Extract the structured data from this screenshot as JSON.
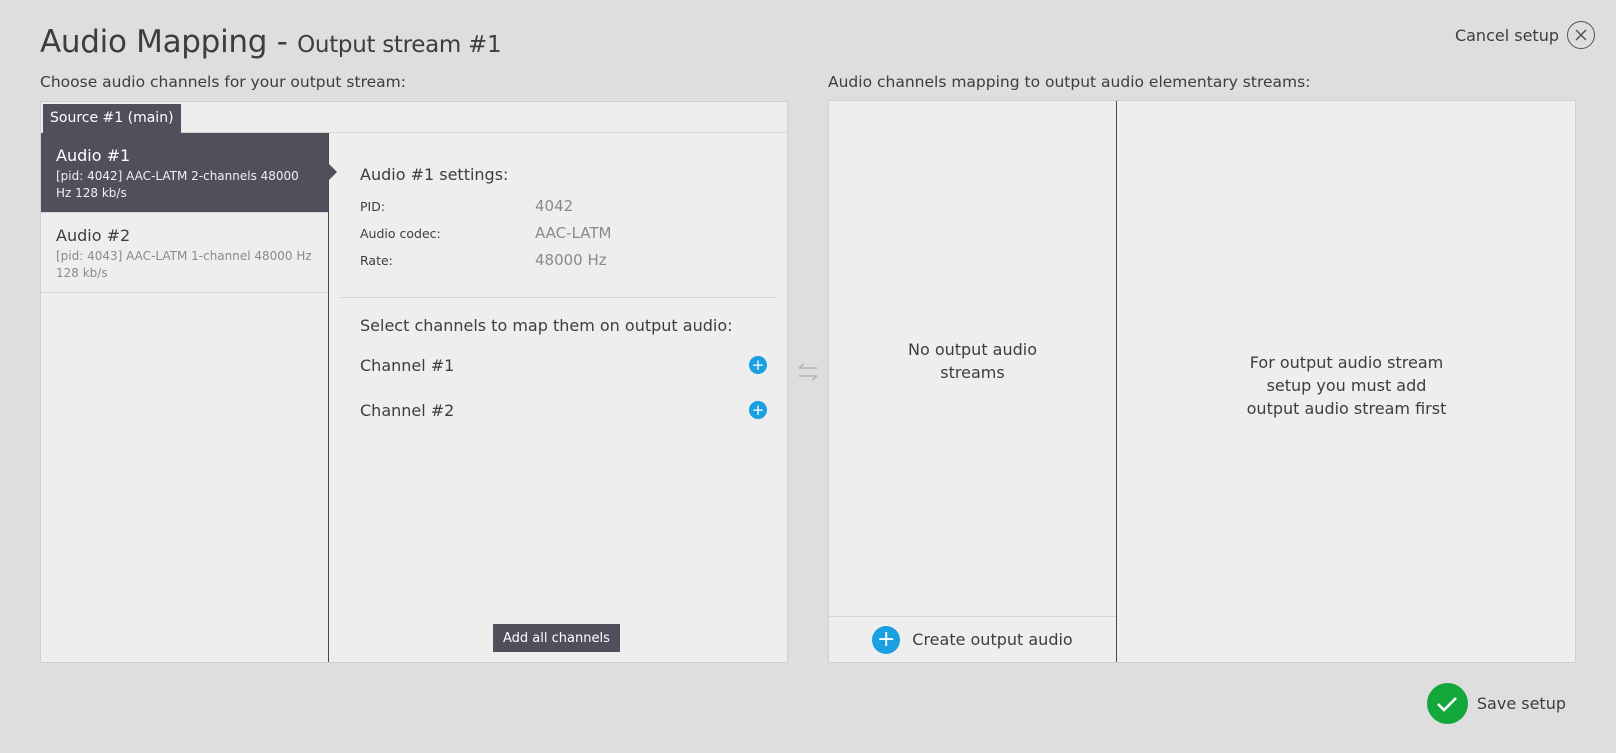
{
  "header": {
    "title": "Audio Mapping - ",
    "subtitle": "Output stream #1",
    "cancel_label": "Cancel setup"
  },
  "left": {
    "label": "Choose audio channels for your output stream:",
    "source_tab": "Source #1 (main)",
    "audio_items": [
      {
        "name": "Audio #1",
        "desc": "[pid: 4042] AAC-LATM 2-channels 48000 Hz 128 kb/s",
        "active": true
      },
      {
        "name": "Audio #2",
        "desc": "[pid: 4043] AAC-LATM 1-channel 48000 Hz 128 kb/s",
        "active": false
      }
    ],
    "settings": {
      "title": "Audio #1 settings:",
      "fields": [
        {
          "key": "PID:",
          "value": "4042"
        },
        {
          "key": "Audio codec:",
          "value": "AAC-LATM"
        },
        {
          "key": "Rate:",
          "value": "48000 Hz"
        }
      ],
      "select_title": "Select channels to map them on output audio:",
      "channels": [
        "Channel #1",
        "Channel #2"
      ],
      "add_all_label": "Add all channels"
    }
  },
  "right": {
    "label": "Audio channels mapping to output audio elementary streams:",
    "no_streams": "No output audio streams",
    "create_label": "Create output audio",
    "info": "For output audio stream setup you must add output audio stream first"
  },
  "footer": {
    "save_label": "Save setup"
  },
  "icons": {
    "close": "close-circle-icon",
    "swap": "swap-arrows-icon",
    "add": "plus-circle-icon",
    "check": "check-circle-icon"
  },
  "colors": {
    "accent_blue": "#1a9fe0",
    "dark_slate": "#4f505c",
    "success_green": "#14a83c"
  }
}
